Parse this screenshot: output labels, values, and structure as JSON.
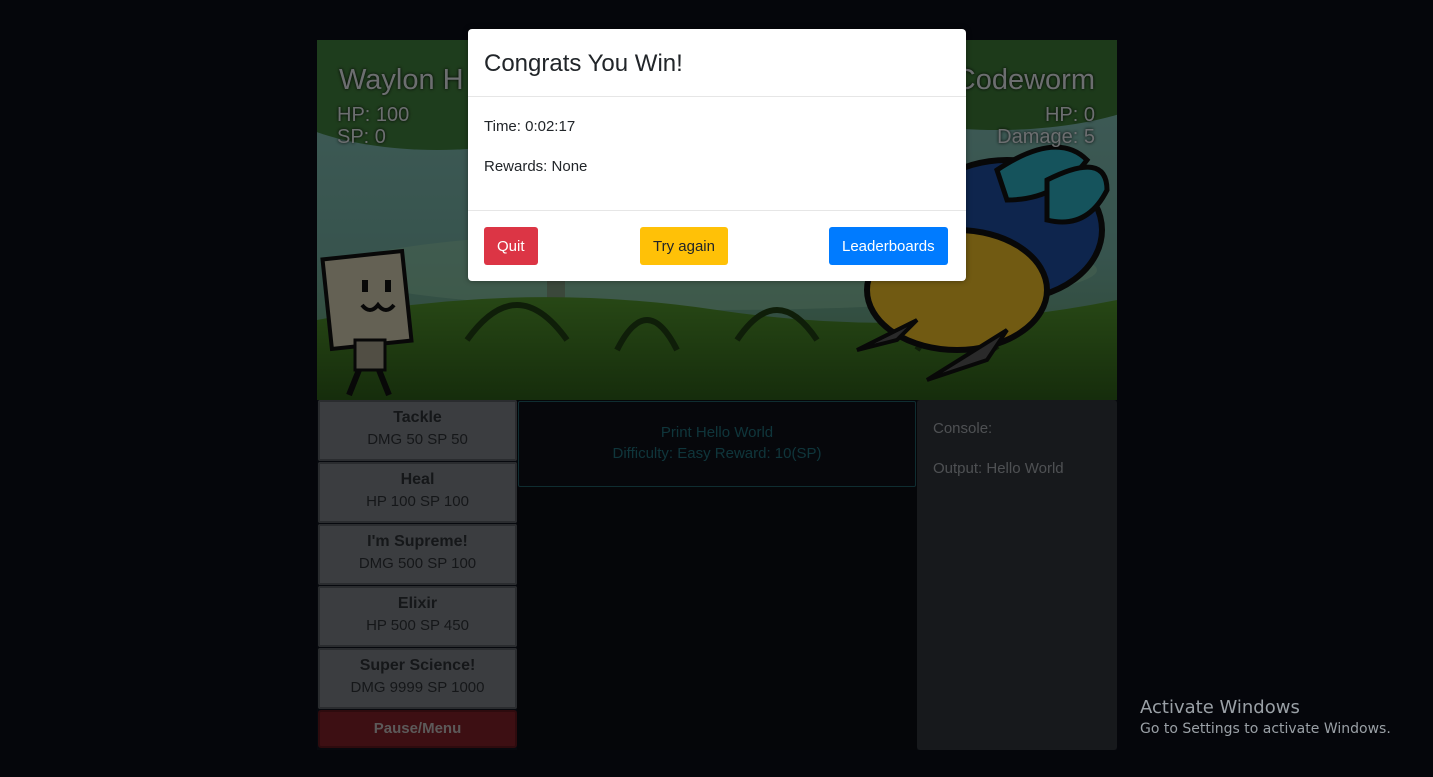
{
  "player": {
    "name": "Waylon H",
    "hp": "HP: 100",
    "sp": "SP: 0"
  },
  "enemy": {
    "name": "Codeworm",
    "hp": "HP: 0",
    "damage": "Damage: 5"
  },
  "moves": [
    {
      "name": "Tackle",
      "stats": "DMG 50 SP 50"
    },
    {
      "name": "Heal",
      "stats": "HP 100 SP 100"
    },
    {
      "name": "I'm Supreme!",
      "stats": "DMG 500 SP 100"
    },
    {
      "name": "Elixir",
      "stats": "HP 500 SP 450"
    },
    {
      "name": "Super Science!",
      "stats": "DMG 9999 SP 1000"
    }
  ],
  "pause_label": "Pause/Menu",
  "challenge": {
    "title": "Print Hello World",
    "details": "Difficulty: Easy Reward: 10(SP)"
  },
  "console": {
    "label": "Console:",
    "output": "Output: Hello World"
  },
  "modal": {
    "title": "Congrats You Win!",
    "time": "Time: 0:02:17",
    "rewards": "Rewards: None",
    "buttons": {
      "quit": "Quit",
      "try_again": "Try again",
      "leaderboards": "Leaderboards"
    }
  },
  "watermark": {
    "line1": "Activate Windows",
    "line2": "Go to Settings to activate Windows."
  },
  "colors": {
    "quit": "#dc3545",
    "try_again": "#ffc107",
    "leaderboards": "#007bff",
    "pause": "#7b1f27"
  }
}
